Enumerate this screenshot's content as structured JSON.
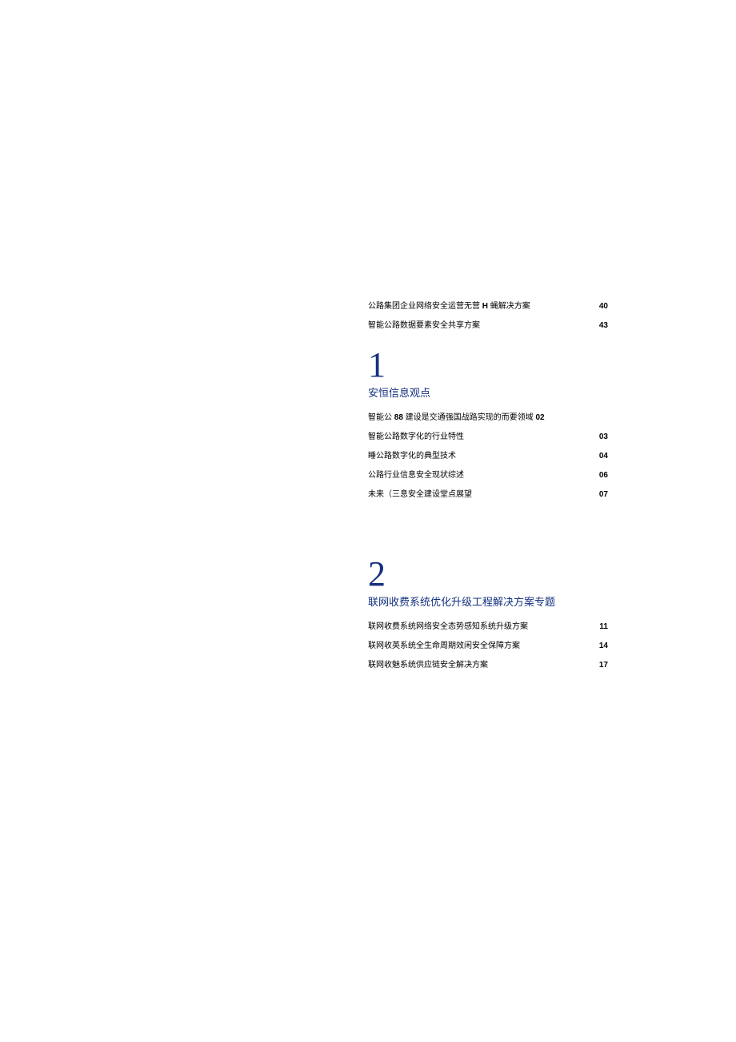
{
  "pre_items": [
    {
      "label_parts": [
        "公路集团企业网络安全运营无营 ",
        "H",
        " 蝇解决方案"
      ],
      "page": "40"
    },
    {
      "label": "智能公路数据要素安全共享方案",
      "page": "43"
    }
  ],
  "chapter1": {
    "num": "1",
    "title": "安恒信息观点",
    "items": [
      {
        "label_parts": [
          "智能公 ",
          "88",
          " 建设是交通强国战路实现的而要领域 ",
          "02"
        ],
        "page": ""
      },
      {
        "label": "智能公路数字化的行业特性",
        "page": "03"
      },
      {
        "label": "睡公路数字化的典型技术",
        "page": "04"
      },
      {
        "label": "公路行业信息安全现状综述",
        "page": "06"
      },
      {
        "label": "未来（三息安全建设堂点展望",
        "page": "07"
      }
    ]
  },
  "chapter2": {
    "num": "2",
    "title": "联网收费系统优化升级工程解决方案专题",
    "items": [
      {
        "label": "联网收费系统网络安全态势感知系统升级方案",
        "page": "11"
      },
      {
        "label": "联网收英系统全生命周期效闲安全保障方案",
        "page": "14"
      },
      {
        "label": "联网收魅系统供应链安全解决方案",
        "page": "17"
      }
    ]
  }
}
